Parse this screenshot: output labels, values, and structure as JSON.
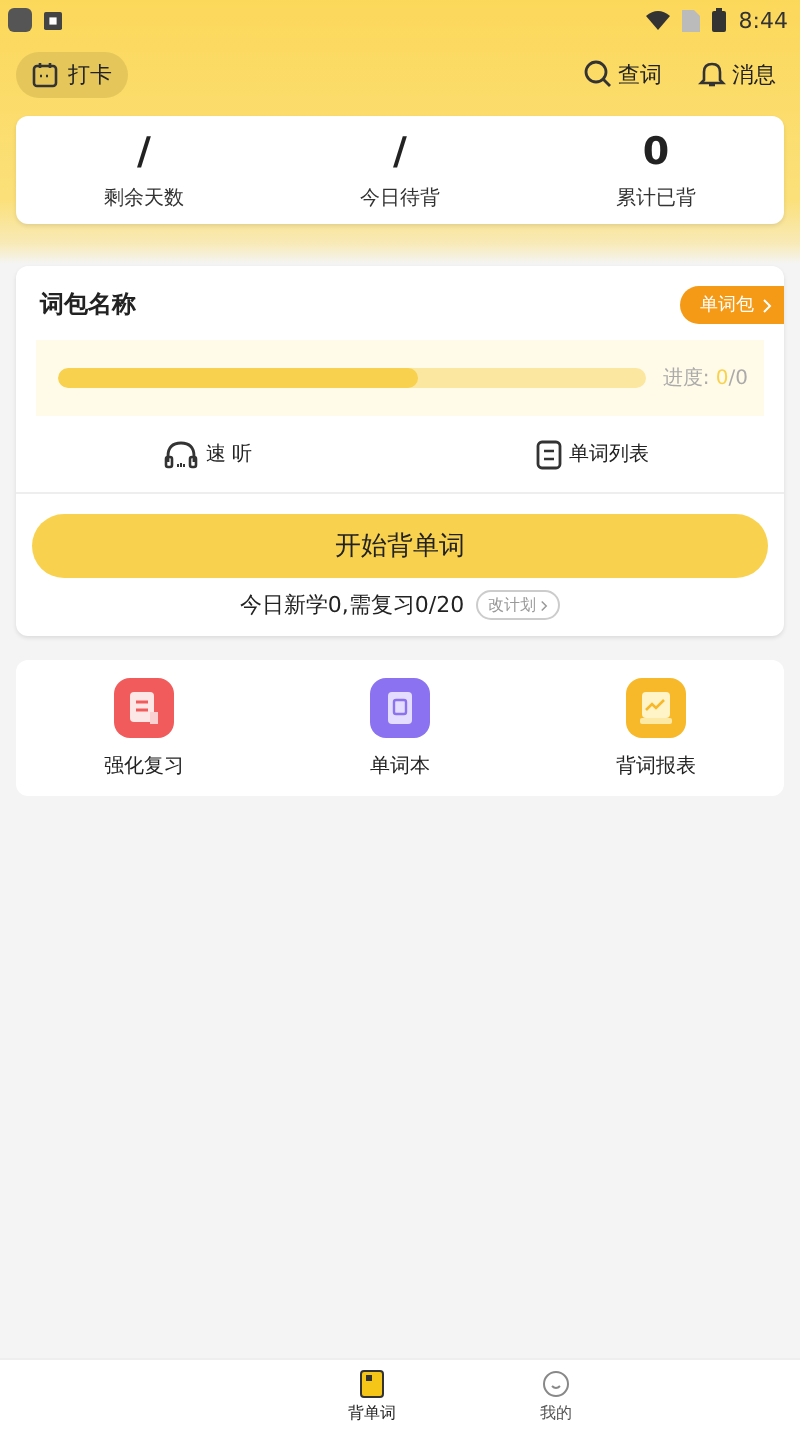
{
  "status_bar": {
    "time": "8:44"
  },
  "header": {
    "checkin": "打卡",
    "actions": [
      {
        "kind": "search",
        "label": "查词"
      },
      {
        "kind": "bell",
        "label": "消息"
      }
    ]
  },
  "stats": [
    {
      "value": "/",
      "label": "剩余天数"
    },
    {
      "value": "/",
      "label": "今日待背"
    },
    {
      "value": "0",
      "label": "累计已背"
    }
  ],
  "wordbook": {
    "title": "词包名称",
    "badge": "单词包",
    "level": 0.61,
    "progress_label": "进度:",
    "progress_done": "0",
    "progress_total": "/0",
    "tools": [
      {
        "kind": "headphones",
        "label": "速 听"
      },
      {
        "kind": "list",
        "label": "单词列表"
      }
    ],
    "start_button": "开始背单词",
    "plan_text": "今日新学0,需复习0/20",
    "plan_button": "改计划"
  },
  "features": [
    {
      "kind": "review",
      "label": "强化复习",
      "color": "#f25b5b"
    },
    {
      "kind": "book",
      "label": "单词本",
      "color": "#8a72f0"
    },
    {
      "kind": "report",
      "label": "背词报表",
      "color": "#f7b92a"
    }
  ],
  "tabs": [
    {
      "kind": "book",
      "label": "背单词",
      "selected": true
    },
    {
      "kind": "face",
      "label": "我的",
      "selected": false
    }
  ]
}
